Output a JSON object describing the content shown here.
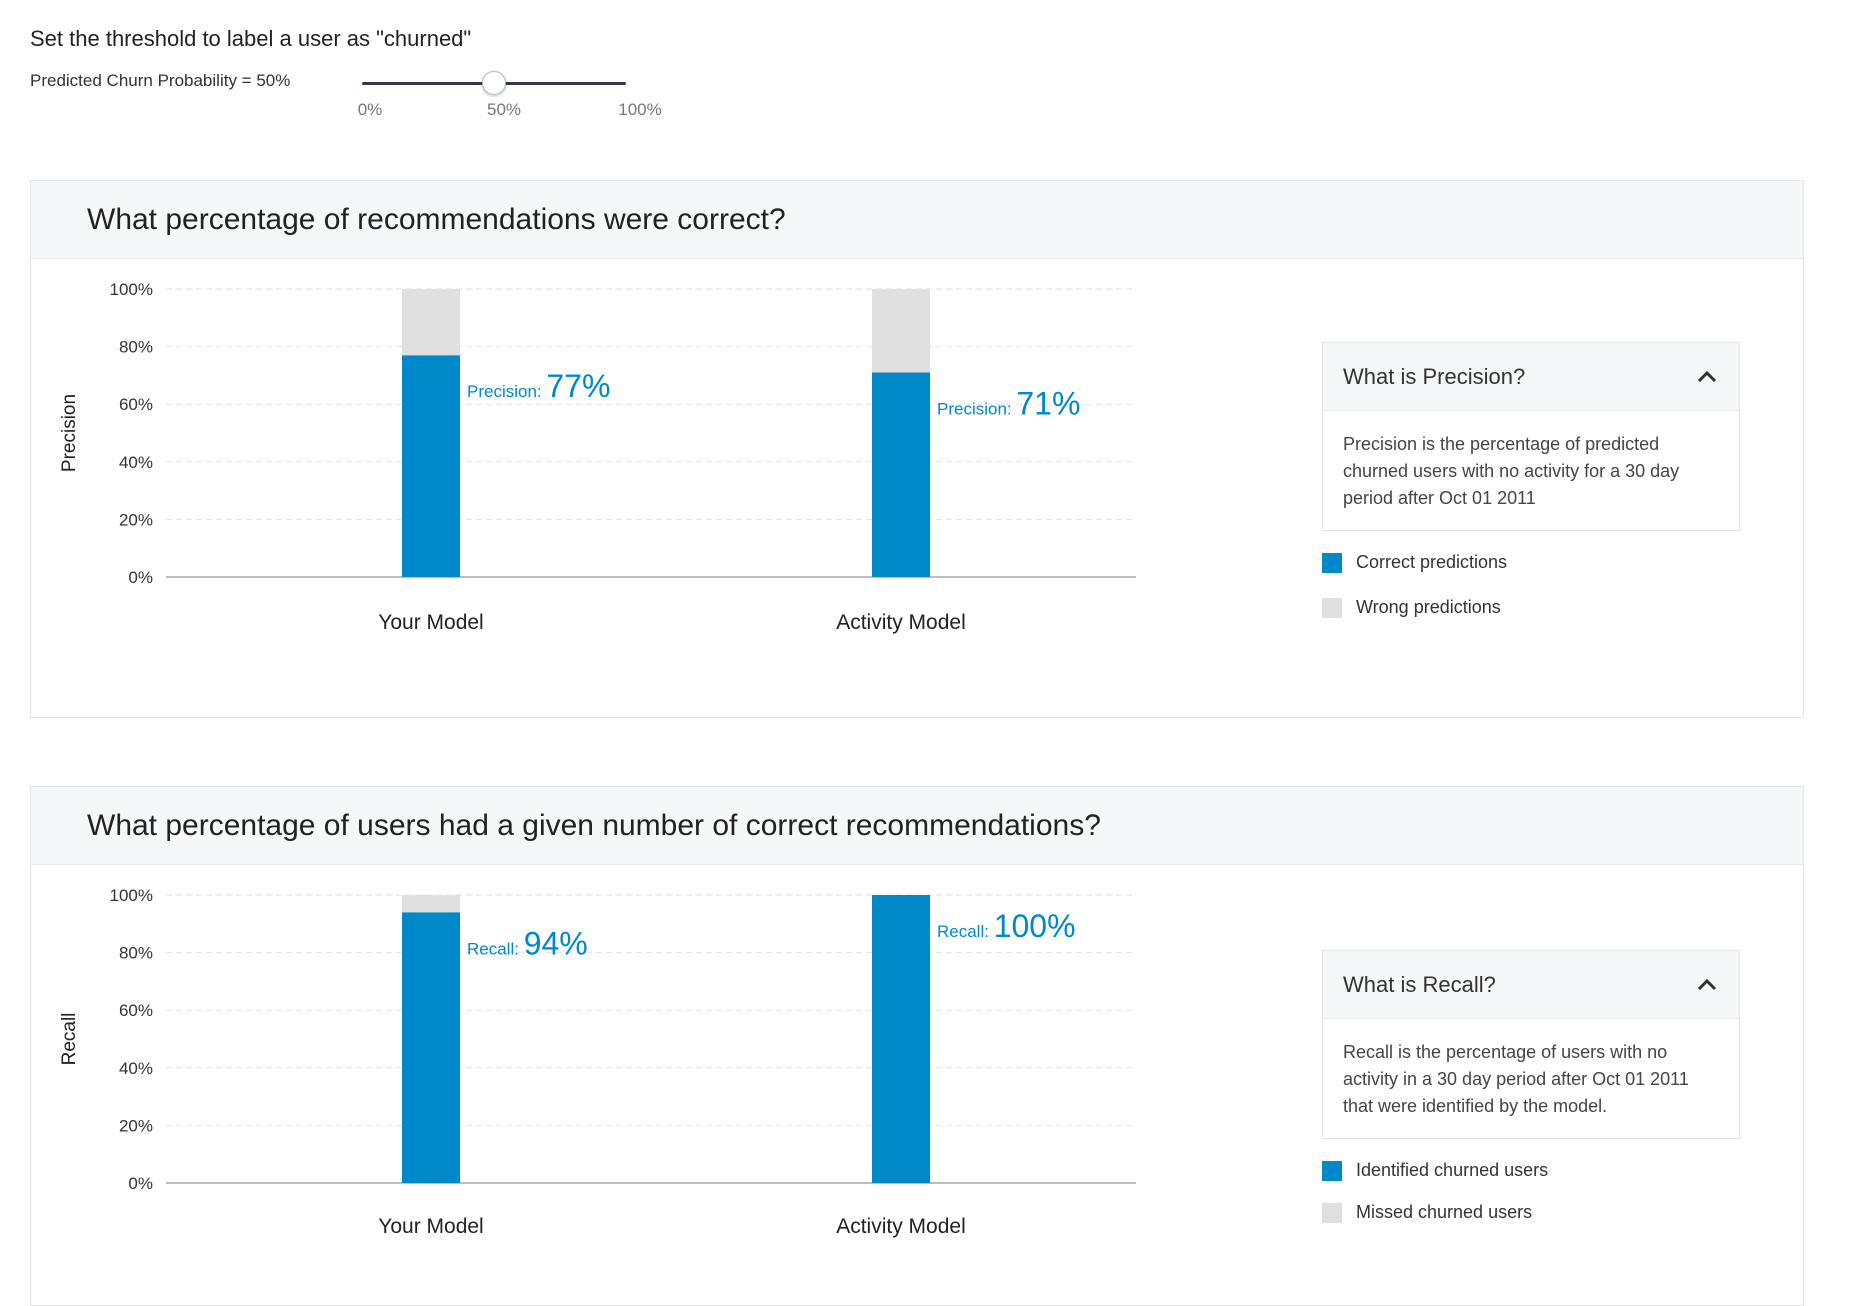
{
  "threshold": {
    "title": "Set the threshold to label a user as \"churned\"",
    "label": "Predicted Churn Probability = 50%",
    "value_percent": 50,
    "ticks": [
      "0%",
      "50%",
      "100%"
    ]
  },
  "colors": {
    "correct": "#0089c9",
    "wrong": "#e0e0e0",
    "accent": "#0089c9"
  },
  "precision": {
    "title": "What percentage of recommendations were correct?",
    "info_title": "What is Precision?",
    "info_text": "Precision is the percentage of predicted churned users with no activity for a 30 day period after Oct 01 2011",
    "legend": [
      "Correct predictions",
      "Wrong predictions"
    ]
  },
  "recall": {
    "title": "What percentage of users had a given number of correct recommendations?",
    "info_title": "What is Recall?",
    "info_text": "Recall is the percentage of users with no activity in a 30 day period after Oct 01 2011 that were identified by the model.",
    "legend": [
      "Identified churned users",
      "Missed churned users"
    ]
  },
  "chart_data": [
    {
      "type": "bar",
      "stacked": true,
      "ylabel": "Precision",
      "ylim": [
        0,
        100
      ],
      "yticks": [
        "0%",
        "20%",
        "40%",
        "60%",
        "80%",
        "100%"
      ],
      "categories": [
        "Your Model",
        "Activity Model"
      ],
      "series": [
        {
          "name": "Correct predictions",
          "values": [
            77,
            71
          ]
        },
        {
          "name": "Wrong predictions",
          "values": [
            23,
            29
          ]
        }
      ],
      "value_label_prefix": "Precision:",
      "value_labels": [
        "77%",
        "71%"
      ],
      "grid": true
    },
    {
      "type": "bar",
      "stacked": true,
      "ylabel": "Recall",
      "ylim": [
        0,
        100
      ],
      "yticks": [
        "0%",
        "20%",
        "40%",
        "60%",
        "80%",
        "100%"
      ],
      "categories": [
        "Your Model",
        "Activity Model"
      ],
      "series": [
        {
          "name": "Identified churned users",
          "values": [
            94,
            100
          ]
        },
        {
          "name": "Missed churned users",
          "values": [
            6,
            0
          ]
        }
      ],
      "value_label_prefix": "Recall:",
      "value_labels": [
        "94%",
        "100%"
      ],
      "grid": true
    }
  ]
}
